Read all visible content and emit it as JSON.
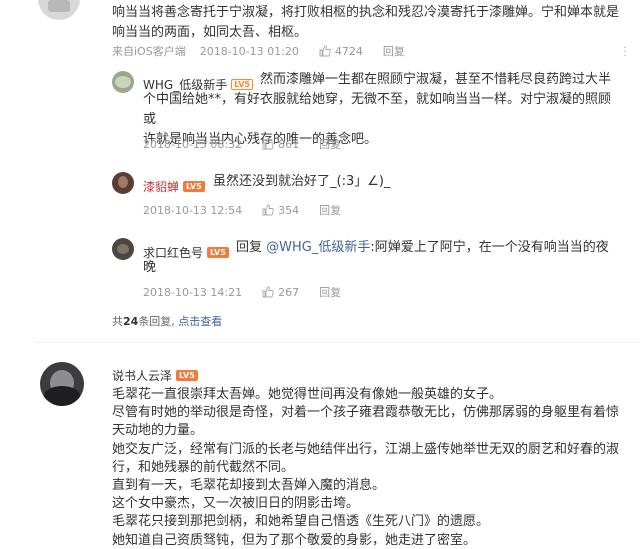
{
  "top_comment": {
    "text_lines": [
      "响当当将善念寄托于宁淑凝，将打败相枢的执念和残忍冷漠寄托于漆雕婵。宁和婵本就是",
      "响当当的两面，如同太吾、相枢。"
    ],
    "source": "来自iOS客户端",
    "time": "2018-10-13 01:20",
    "likes": "4724",
    "reply_label": "回复",
    "more": "⋮"
  },
  "replies": [
    {
      "author": "WHG_低级新手",
      "level": "LV5",
      "text_lines": [
        "然而漆雕婵一生都在照顾宁淑凝，甚至不惜耗尽良药跨过大半",
        "个中国给她**，有好衣服就给她穿，无微不至，就如响当当一样。对宁淑凝的照顾或",
        "许就是响当当内心残存的唯一的善念吧。"
      ],
      "time": "2018-10-13 08:32",
      "likes": "861",
      "reply_label": "回复"
    },
    {
      "author": "漆貂蝉",
      "level": "LV5",
      "text_lines": [
        "虽然还没到就治好了_(:3」∠)_"
      ],
      "time": "2018-10-13 12:54",
      "likes": "354",
      "reply_label": "回复"
    },
    {
      "author": "求口红色号",
      "level": "LV5",
      "reply_prefix": "回复",
      "mention": "@WHG_低级新手",
      "text_after": ":阿婵爱上了阿宁，在一个没有响当当的夜",
      "text_line2": "晚",
      "time": "2018-10-13 14:21",
      "likes": "267",
      "reply_label": "回复"
    }
  ],
  "summary": {
    "prefix": "共",
    "count": "24",
    "suffix": "条回复,",
    "link": "点击查看"
  },
  "main_comment": {
    "author": "说书人云泽",
    "level": "LV5",
    "text_lines": [
      "毛翠花一直很崇拜太吾婵。她觉得世间再没有像她一般英雄的女子。",
      "尽管有时她的举动很是奇怪，对着一个孩子雍君霞恭敬无比，仿佛那孱弱的身躯里有着惊",
      "天动地的力量。",
      "她交友广泛，经常有门派的长老与她结伴出行，江湖上盛传她举世无双的厨艺和好春的淑",
      "行，和她残暴的前代截然不同。",
      "直到有一天，毛翠花却接到太吾婵入魔的消息。",
      "这个女中豪杰，又一次被旧日的阴影击垮。",
      "毛翠花只接到那把剑柄，和她希望自己悟透《生死八门》的遗愿。",
      "她知道自己资质驽钝，但为了那个敬爱的身影，她走进了密室。"
    ]
  }
}
